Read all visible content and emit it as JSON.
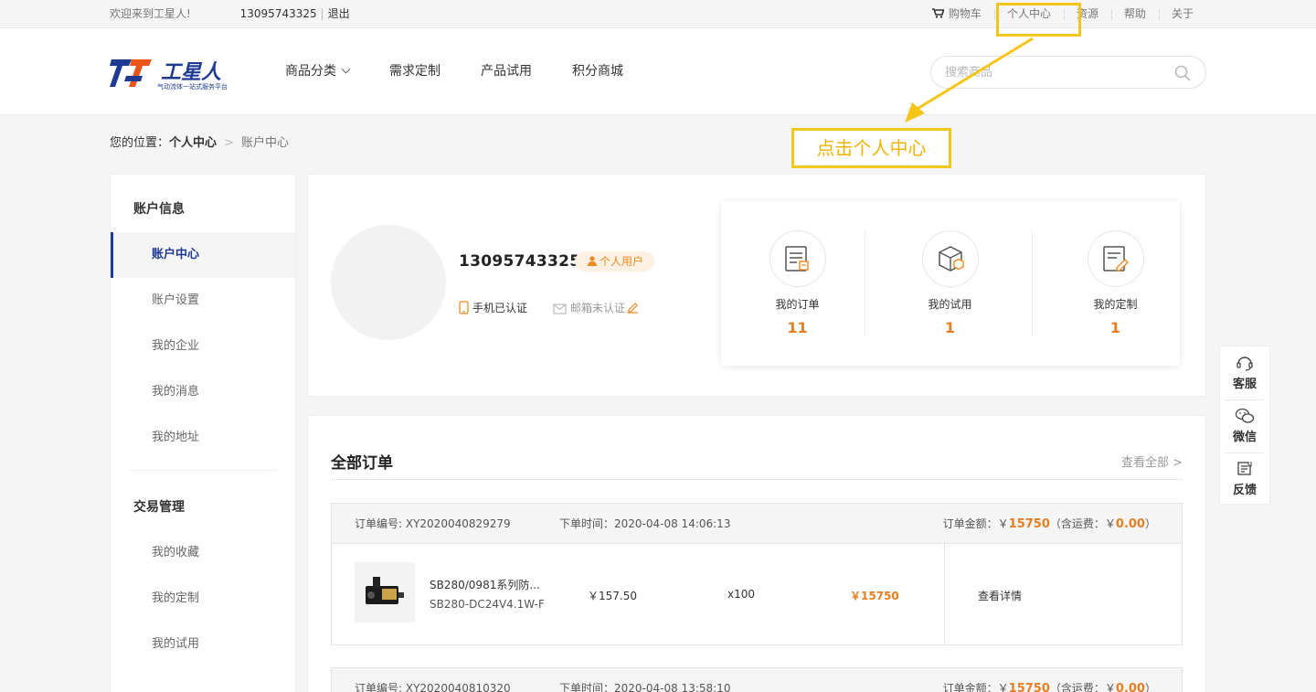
{
  "topbar": {
    "welcome": "欢迎来到工星人!",
    "phone": "13095743325",
    "separator": "|",
    "logout": "退出",
    "links": [
      "购物车",
      "个人中心",
      "资源",
      "帮助",
      "关于"
    ]
  },
  "header": {
    "logo_name": "工星人",
    "logo_slogan": "气动流体一站式服务平台",
    "nav": [
      "商品分类",
      "需求定制",
      "产品试用",
      "积分商城"
    ],
    "search_placeholder": "搜索商品"
  },
  "breadcrumb": {
    "prefix": "您的位置：",
    "parent": "个人中心",
    "arrow": ">",
    "current": "账户中心"
  },
  "sidebar": {
    "group1_title": "账户信息",
    "group1_items": [
      "账户中心",
      "账户设置",
      "我的企业",
      "我的消息",
      "我的地址"
    ],
    "group2_title": "交易管理",
    "group2_items": [
      "我的收藏",
      "我的定制",
      "我的试用"
    ]
  },
  "profile": {
    "username": "13095743325",
    "badge": "个人用户",
    "phone_status": "手机已认证",
    "email_status": "邮箱未认证",
    "stats": [
      {
        "label": "我的订单",
        "value": "11",
        "icon": "order-icon"
      },
      {
        "label": "我的试用",
        "value": "1",
        "icon": "box-icon"
      },
      {
        "label": "我的定制",
        "value": "1",
        "icon": "custom-icon"
      }
    ]
  },
  "orders": {
    "title": "全部订单",
    "view_all": "查看全部 >",
    "list": [
      {
        "no_label": "订单编号: XY2020040829279",
        "time_label": "下单时间：2020-04-08 14:06:13",
        "amount_prefix": "订单金额：￥",
        "amount": "15750",
        "ship_prefix": "（含运费：￥",
        "ship": "0.00",
        "ship_suffix": "）",
        "product_name": "SB280/0981系列防...",
        "product_model": "SB280-DC24V4.1W-F",
        "price": "￥157.50",
        "qty": "x100",
        "total": "￥15750",
        "detail": "查看详情"
      },
      {
        "no_label": "订单编号: XY2020040810320",
        "time_label": "下单时间：2020-04-08 13:58:10",
        "amount_prefix": "订单金额：￥",
        "amount": "15750",
        "ship_prefix": "（含运费：￥",
        "ship": "0.00",
        "ship_suffix": "）"
      }
    ]
  },
  "float_panel": [
    "客服",
    "微信",
    "反馈"
  ],
  "annotation": {
    "label": "点击个人中心",
    "color": "#f5c518"
  },
  "colors": {
    "brand_blue": "#1f3a93",
    "accent_orange": "#e67e22"
  }
}
